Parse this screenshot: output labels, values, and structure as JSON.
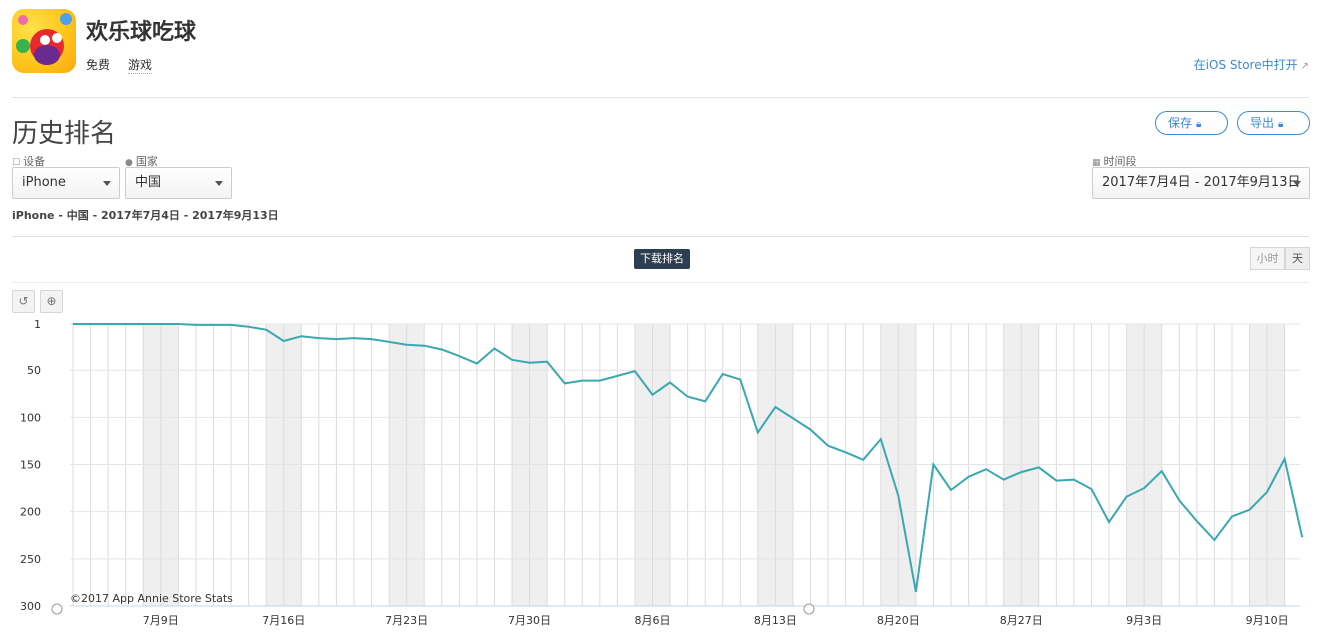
{
  "app": {
    "name": "欢乐球吃球",
    "price": "免费",
    "genre": "游戏",
    "open_store_label": "在iOS Store中打开"
  },
  "section": {
    "title": "历史排名",
    "save_label": "保存",
    "export_label": "导出"
  },
  "filters": {
    "device_label": "设备",
    "device_value": "iPhone",
    "country_label": "国家",
    "country_value": "中国",
    "period_label": "时间段",
    "period_value": "2017年7月4日 - 2017年9月13日"
  },
  "summary": "iPhone - 中国 - 2017年7月4日 - 2017年9月13日",
  "series_toggle": "下载排名",
  "granularity": {
    "hour": "小时",
    "day": "天"
  },
  "tools": {
    "reset_icon": "reset-icon",
    "zoom_icon": "zoom-icon"
  },
  "colors": {
    "line": "#3aa8b0",
    "accent": "#3b8bd0",
    "weekend": "#efefef"
  },
  "chart_data": {
    "type": "line",
    "title": "",
    "xlabel": "",
    "ylabel": "",
    "y_inverted": true,
    "ylim": [
      1,
      300
    ],
    "yticks": [
      1,
      50,
      100,
      150,
      200,
      250,
      300
    ],
    "x_start": "2017-07-04",
    "x_end": "2017-09-13",
    "xtick_labels": [
      "7月9日",
      "7月16日",
      "7月23日",
      "7月30日",
      "8月6日",
      "8月13日",
      "8月20日",
      "8月27日",
      "9月3日",
      "9月10日"
    ],
    "credit": "©2017 App Annie Store Stats",
    "series": [
      {
        "values": [
          1,
          1,
          1,
          1,
          1,
          1,
          1,
          2,
          2,
          2,
          4,
          7,
          19,
          14,
          16,
          17,
          16,
          17,
          20,
          23,
          24,
          28,
          35,
          43,
          27,
          39,
          42,
          41,
          64,
          61,
          61,
          56,
          51,
          76,
          63,
          78,
          83,
          54,
          60,
          116,
          89,
          101,
          113,
          130,
          137,
          145,
          123,
          183,
          285,
          150,
          177,
          163,
          155,
          166,
          158,
          153,
          167,
          166,
          176,
          211,
          184,
          175,
          157,
          188,
          210,
          230,
          205,
          198,
          179,
          144,
          227
        ]
      }
    ]
  }
}
